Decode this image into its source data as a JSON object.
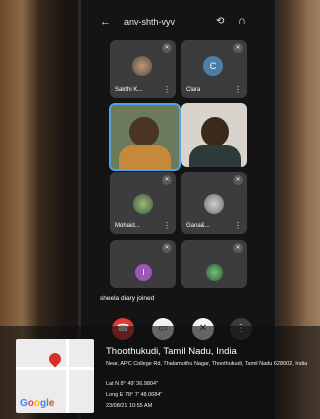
{
  "header": {
    "title": "anv-shth-vyv",
    "back_icon": "arrow-left-icon",
    "switch_icon": "camera-switch-icon",
    "audio_icon": "headphones-icon"
  },
  "tiles": [
    {
      "name": "Sakthi K...",
      "initial": ""
    },
    {
      "name": "Clara",
      "initial": "C"
    },
    {
      "name": "",
      "initial": ""
    },
    {
      "name": "",
      "initial": ""
    },
    {
      "name": "Mohaid...",
      "initial": ""
    },
    {
      "name": "Gana&...",
      "initial": ""
    },
    {
      "name": "",
      "initial": "I"
    },
    {
      "name": "",
      "initial": ""
    }
  ],
  "notification": "sheela diary joined",
  "controls": {
    "end_icon": "phone-end-icon",
    "camera_icon": "camera-off-icon",
    "mic_icon": "mic-off-icon",
    "more_icon": "more-icon"
  },
  "location": {
    "title": "Thoothukudi, Tamil Nadu, India",
    "address": "Near, APC College Rd, Thalamuthu Nagar, Thoothukudi, Tamil Nadu 628002, India",
    "lat": "Lat N 8° 49' 36.9804\"",
    "long": "Long E 78° 7' 48.0684\"",
    "datetime": "23/08/21 10:55 AM",
    "map_logo": "Google"
  },
  "colors": {
    "end_call": "#e53935",
    "highlight": "#4fa3e0",
    "clara_avatar": "#4e7ea8",
    "i_avatar": "#9b59b6"
  }
}
